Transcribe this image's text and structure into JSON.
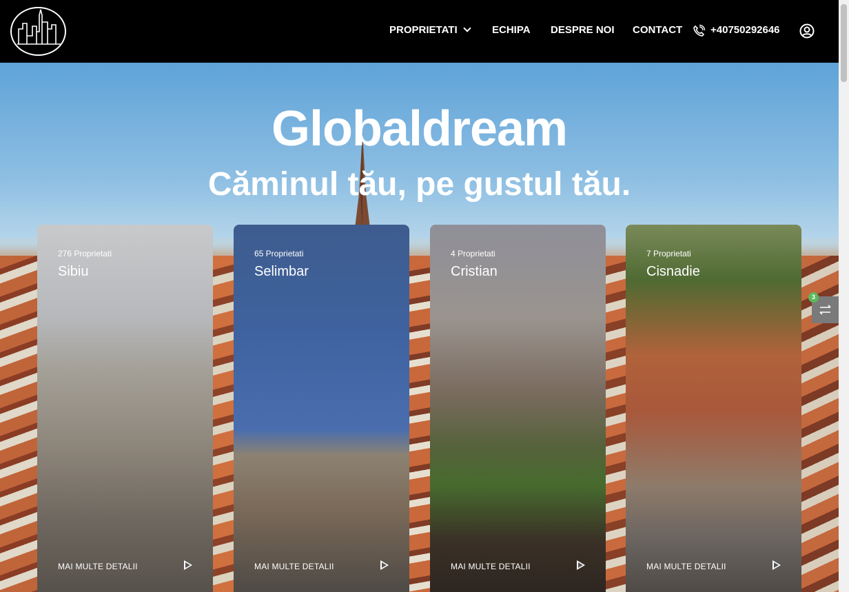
{
  "header": {
    "nav": {
      "proprietati": "PROPRIETATI",
      "echipa": "ECHIPA",
      "despre": "DESPRE NOI",
      "contact": "CONTACT",
      "phone": "+40750292646"
    },
    "icons": [
      "logo-skyline-icon",
      "chevron-down-icon",
      "phone-icon",
      "user-icon"
    ]
  },
  "hero": {
    "title": "Globaldream",
    "subtitle": "Căminul tău, pe gustul tău."
  },
  "cards": [
    {
      "count": "276 Proprietati",
      "name": "Sibiu",
      "more": "MAI MULTE DETALII"
    },
    {
      "count": "65 Proprietati",
      "name": "Selimbar",
      "more": "MAI MULTE DETALII"
    },
    {
      "count": "4 Proprietati",
      "name": "Cristian",
      "more": "MAI MULTE DETALII"
    },
    {
      "count": "7 Proprietati",
      "name": "Cisnadie",
      "more": "MAI MULTE DETALII"
    }
  ],
  "compare": {
    "badge": "3",
    "icon": "swap-arrows-icon"
  },
  "colors": {
    "header_bg": "#000000",
    "text": "#ffffff",
    "badge": "#5cb85c"
  }
}
